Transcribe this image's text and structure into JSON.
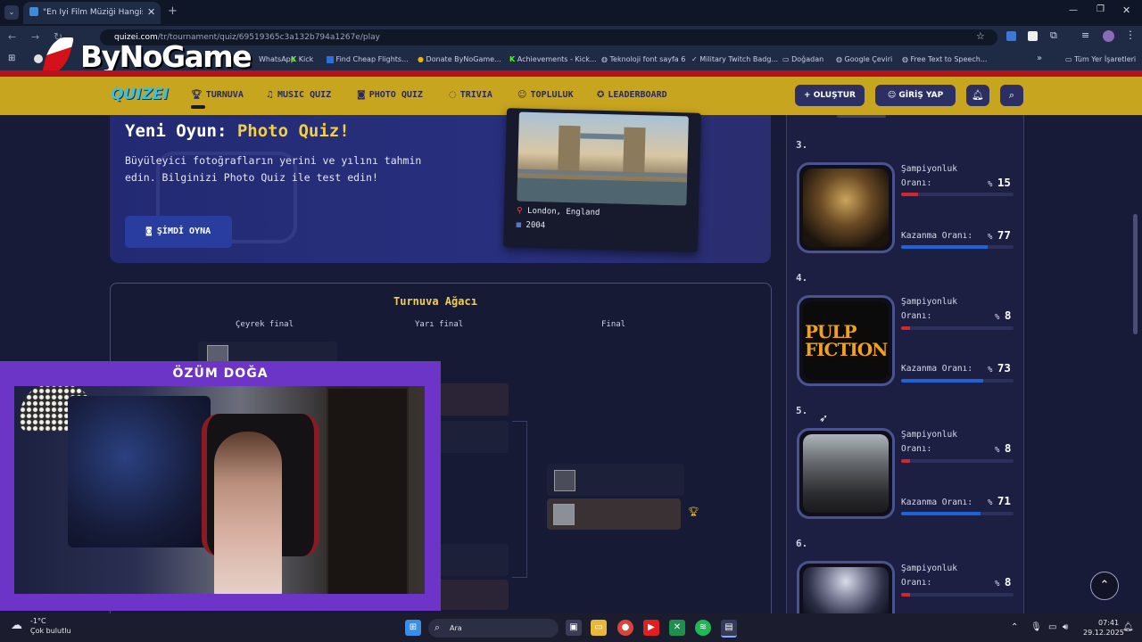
{
  "browser": {
    "tab_title": "\"En İyi Film Müziği Hangisi? 🎬 🎵",
    "url_domain": "quizei.com",
    "url_path": "/tr/tournament/quiz/69519365c3a132b794a1267e/play",
    "bookmarks": [
      "WhatsApp",
      "Kick",
      "Find Cheap Flights...",
      "Donate ByNoGame...",
      "Achievements - Kick...",
      "Teknoloji font sayfa 6",
      "Military Twitch Badg...",
      "Doğadan",
      "Google Çeviri",
      "Free Text to Speech..."
    ],
    "all_bookmarks_label": "Tüm Yer İşaretleri",
    "watermark": "ByNoGame"
  },
  "nav": {
    "logo": "QUIZEI",
    "items": [
      {
        "label": "TURNUVA",
        "icon": "trophy-icon"
      },
      {
        "label": "MUSIC QUIZ",
        "icon": "music-icon"
      },
      {
        "label": "PHOTO QUIZ",
        "icon": "camera-icon"
      },
      {
        "label": "TRIVIA",
        "icon": "chat-icon"
      },
      {
        "label": "TOPLULUK",
        "icon": "users-icon"
      },
      {
        "label": "LEADERBOARD",
        "icon": "award-icon"
      }
    ],
    "create_label": "OLUŞTUR",
    "login_label": "GİRİŞ YAP"
  },
  "banner": {
    "title_prefix": "Yeni Oyun:",
    "title_highlight": "Photo Quiz!",
    "description": "Büyüleyici fotoğrafların yerini ve yılını tahmin edin. Bilginizi Photo Quiz ile test edin!",
    "button_label": "ŞİMDİ OYNA",
    "photo_location": "London, England",
    "photo_year": "2004"
  },
  "bracket": {
    "title": "Turnuva Ağacı",
    "rounds": [
      "Çeyrek final",
      "Yarı final",
      "Final"
    ]
  },
  "stream": {
    "streamer_name": "ÖZÜM DOĞA"
  },
  "leaderboard": {
    "champion_label": "Şampiyonluk Oranı:",
    "win_label": "Kazanma Oranı:",
    "entries": [
      {
        "rank": "3.",
        "poster": "harry-potter-poster",
        "champion_rate": "15",
        "win_rate": "77"
      },
      {
        "rank": "4.",
        "poster": "pulp-fiction-poster",
        "poster_text_1": "PULP",
        "poster_text_2": "FICTION",
        "champion_rate": "8",
        "win_rate": "73"
      },
      {
        "rank": "5.",
        "poster": "battle-crowd-poster",
        "champion_rate": "8",
        "win_rate": "71"
      },
      {
        "rank": "6.",
        "poster": "sky-poster",
        "champion_rate": "8",
        "win_rate": ""
      }
    ]
  },
  "taskbar": {
    "weather_temp": "-1°C",
    "weather_desc": "Çok bulutlu",
    "search_label": "Ara",
    "time": "07:41",
    "date": "29.12.2025"
  },
  "colors": {
    "nav_bg": "#c8a51e",
    "accent_yellow": "#f4cf43",
    "bar_red": "#d3262e",
    "bar_blue": "#1c63d8",
    "stream_purple": "#6c35c7"
  }
}
